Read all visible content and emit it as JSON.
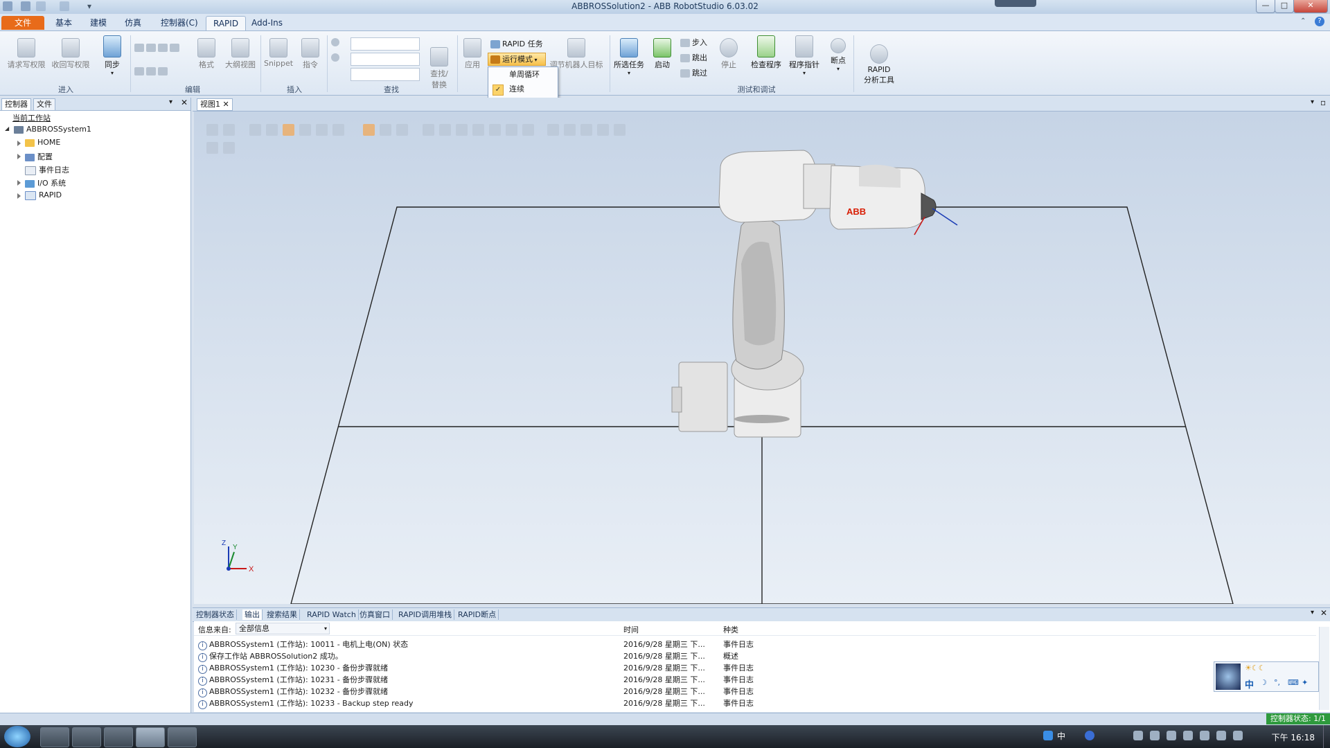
{
  "window": {
    "title": "ABBROSSolution2 - ABB RobotStudio 6.03.02",
    "minimize": "—",
    "maximize": "□",
    "close": "✕"
  },
  "menu_tabs": [
    "文件 (F)",
    "基本",
    "建模",
    "仿真",
    "控制器(C)",
    "RAPID",
    "Add-Ins"
  ],
  "active_tab": "RAPID",
  "ribbon": {
    "enter": {
      "request_write": "请求写权限",
      "release_write": "收回写权限",
      "sync": "同步",
      "label": "进入"
    },
    "edit": {
      "format": "格式",
      "outline": "大纲视图",
      "label": "编辑"
    },
    "insert": {
      "snippet": "Snippet",
      "instruction": "指令",
      "label": "插入"
    },
    "find": {
      "find_replace": "查找/\n替换",
      "label": "查找"
    },
    "apply": "应用",
    "rapid_task": "RAPID 任务",
    "run_mode": "运行模式",
    "adjust_target": "调节机器人目标",
    "test": {
      "selected_tasks": "所选任务",
      "start": "启动",
      "step_in": "步入",
      "step_out": "跳出",
      "step_over": "跳过",
      "stop": "停止",
      "check_program": "检查程序",
      "program_pointer": "程序指针",
      "breakpoint": "断点",
      "label": "测试和调试"
    },
    "rapid_analysis": "RAPID\n分析工具"
  },
  "dropdown": {
    "items": [
      "单周循环",
      "连续"
    ],
    "checked_index": 1
  },
  "left_panel": {
    "tabs": [
      "控制器",
      "文件"
    ],
    "heading": "当前工作站",
    "system": "ABBROSSystem1",
    "nodes": [
      "HOME",
      "配置",
      "事件日志",
      "I/O 系统",
      "RAPID"
    ]
  },
  "view": {
    "tab": "视图1",
    "axes": {
      "x": "X",
      "y": "Y",
      "z": "Z"
    },
    "logo": "ABB"
  },
  "bottom_tabs": [
    "控制器状态",
    "输出",
    "搜索结果",
    "RAPID Watch",
    "仿真窗口",
    "RAPID调用堆栈",
    "RAPID断点"
  ],
  "output": {
    "filter_label": "信息来自:",
    "filter_value": "全部信息",
    "columns": [
      "时间",
      "种类"
    ],
    "rows": [
      {
        "msg": "ABBROSSystem1 (工作站): 10011 - 电机上电(ON) 状态",
        "time": "2016/9/28 星期三 下...",
        "type": "事件日志"
      },
      {
        "msg": "保存工作站 ABBROSSolution2 成功。",
        "time": "2016/9/28 星期三 下...",
        "type": "概述"
      },
      {
        "msg": "ABBROSSystem1 (工作站): 10230 - 备份步骤就绪",
        "time": "2016/9/28 星期三 下...",
        "type": "事件日志"
      },
      {
        "msg": "ABBROSSystem1 (工作站): 10231 - 备份步骤就绪",
        "time": "2016/9/28 星期三 下...",
        "type": "事件日志"
      },
      {
        "msg": "ABBROSSystem1 (工作站): 10232 - 备份步骤就绪",
        "time": "2016/9/28 星期三 下...",
        "type": "事件日志"
      },
      {
        "msg": "ABBROSSystem1 (工作站): 10233 - Backup step ready",
        "time": "2016/9/28 星期三 下...",
        "type": "事件日志"
      }
    ]
  },
  "status": {
    "controller_state": "控制器状态: 1/1"
  },
  "taskbar": {
    "clock": "下午 16:18",
    "ime": "中"
  },
  "ime_bar": {
    "lang": "中"
  },
  "colors": {
    "file_tab": "#e86b1a",
    "ribbon_bg": "#f4f7fb",
    "status_green": "#2e9a3d",
    "robot_body": "#e6e6e6",
    "abb_red": "#d81e05"
  }
}
